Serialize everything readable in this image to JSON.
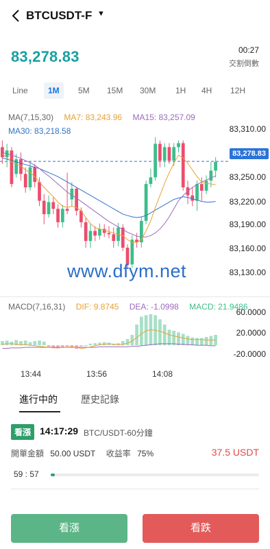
{
  "header": {
    "title": "BTCUSDT-F"
  },
  "ticker": {
    "price": "83,278.83",
    "countdown": "00:27",
    "countdown_label": "交割倒數"
  },
  "intervals": [
    "Line",
    "1M",
    "5M",
    "15M",
    "30M",
    "1H",
    "4H",
    "12H"
  ],
  "active_interval": "1M",
  "indicators": {
    "ma_label": "MA(7,15,30)",
    "ma7": "MA7: 83,243.96",
    "ma15": "MA15: 83,257.09",
    "ma30": "MA30: 83,218.58"
  },
  "colors": {
    "up": "#3ebd8a",
    "down": "#ec4d6d",
    "ma7": "#e8a033",
    "ma15": "#9b6bbd",
    "ma30": "#2f73c8",
    "price_text": "#1aa0a0"
  },
  "price_axis": [
    "83,310.00",
    "83,278.83",
    "83,250.00",
    "83,220.00",
    "83,190.00",
    "83,160.00",
    "83,130.00"
  ],
  "watermark": "www.dfym.net",
  "macd": {
    "label": "MACD(7,16,31)",
    "dif": "DIF: 9.8745",
    "dea": "DEA: -1.0998",
    "macd": "MACD: 21.9486",
    "axis": [
      "60.0000",
      "20.0000",
      "-20.0000"
    ]
  },
  "time_axis": [
    "13:44",
    "13:56",
    "14:08"
  ],
  "tabs": {
    "active": "進行中的",
    "history": "歷史記錄"
  },
  "order": {
    "direction": "看漲",
    "time": "14:17:29",
    "pair": "BTC/USDT-60分鐘",
    "amount_label": "開單金額",
    "amount": "50.00 USDT",
    "rate_label": "收益率",
    "rate": "75%",
    "profit": "37.5 USDT",
    "timer": "59 : 57",
    "progress": 0.02
  },
  "actions": {
    "call": "看漲",
    "put": "看跌"
  },
  "chart_data": {
    "type": "candlestick",
    "y_range": [
      83110,
      83325
    ],
    "last_price": 83278.83,
    "candles": [
      [
        83300,
        83285,
        83310,
        83275
      ],
      [
        83285,
        83295,
        83305,
        83270
      ],
      [
        83295,
        83245,
        83300,
        83240
      ],
      [
        83260,
        83282,
        83290,
        83255
      ],
      [
        83282,
        83260,
        83292,
        83250
      ],
      [
        83260,
        83240,
        83270,
        83232
      ],
      [
        83240,
        83270,
        83278,
        83235
      ],
      [
        83270,
        83248,
        83275,
        83240
      ],
      [
        83248,
        83220,
        83255,
        83212
      ],
      [
        83220,
        83200,
        83230,
        83185
      ],
      [
        83200,
        83218,
        83228,
        83195
      ],
      [
        83218,
        83208,
        83225,
        83200
      ],
      [
        83208,
        83188,
        83215,
        83180
      ],
      [
        83188,
        83208,
        83214,
        83180
      ],
      [
        83208,
        83205,
        83262,
        83200
      ],
      [
        83222,
        83238,
        83248,
        83212
      ],
      [
        83238,
        83205,
        83240,
        83198
      ],
      [
        83205,
        83188,
        83210,
        83180
      ],
      [
        83188,
        83160,
        83195,
        83150
      ],
      [
        83160,
        83175,
        83185,
        83150
      ],
      [
        83175,
        83168,
        83182,
        83160
      ],
      [
        83168,
        83178,
        83186,
        83162
      ],
      [
        83178,
        83172,
        83185,
        83166
      ],
      [
        83172,
        83170,
        83182,
        83164
      ],
      [
        83170,
        83160,
        83180,
        83150
      ],
      [
        83160,
        83180,
        83187,
        83152
      ],
      [
        83180,
        83150,
        83185,
        83145
      ],
      [
        83150,
        83125,
        83155,
        83120
      ],
      [
        83125,
        83162,
        83168,
        83120
      ],
      [
        83162,
        83158,
        83172,
        83150
      ],
      [
        83158,
        83190,
        83196,
        83150
      ],
      [
        83190,
        83245,
        83250,
        83185
      ],
      [
        83245,
        83255,
        83268,
        83240
      ],
      [
        83255,
        83305,
        83315,
        83250
      ],
      [
        83305,
        83280,
        83310,
        83270
      ],
      [
        83280,
        83300,
        83306,
        83270
      ],
      [
        83300,
        83280,
        83306,
        83275
      ],
      [
        83280,
        83300,
        83306,
        83272
      ],
      [
        83300,
        83306,
        83310,
        83292
      ],
      [
        83306,
        83240,
        83310,
        83235
      ],
      [
        83240,
        83228,
        83250,
        83215
      ],
      [
        83228,
        83220,
        83240,
        83212
      ],
      [
        83220,
        83245,
        83250,
        83205
      ],
      [
        83245,
        83235,
        83255,
        83220
      ],
      [
        83235,
        83250,
        83258,
        83230
      ],
      [
        83250,
        83265,
        83278,
        83240
      ],
      [
        83265,
        83278,
        83285,
        83255
      ]
    ],
    "ma7": [
      83290,
      83284,
      83278,
      83275,
      83272,
      83266,
      83262,
      83256,
      83248,
      83240,
      83233,
      83226,
      83218,
      83212,
      83210,
      83212,
      83210,
      83205,
      83195,
      83186,
      83180,
      83178,
      83176,
      83174,
      83172,
      83170,
      83168,
      83162,
      83158,
      83158,
      83162,
      83175,
      83190,
      83210,
      83228,
      83246,
      83262,
      83276,
      83288,
      83284,
      83276,
      83266,
      83256,
      83248,
      83246,
      83245,
      83244
    ],
    "ma15": [
      83292,
      83290,
      83288,
      83286,
      83283,
      83280,
      83277,
      83273,
      83268,
      83262,
      83257,
      83251,
      83245,
      83239,
      83233,
      83228,
      83224,
      83219,
      83214,
      83209,
      83204,
      83199,
      83194,
      83189,
      83185,
      83181,
      83177,
      83173,
      83170,
      83167,
      83166,
      83166,
      83168,
      83172,
      83178,
      83186,
      83196,
      83208,
      83220,
      83228,
      83234,
      83240,
      83244,
      83248,
      83251,
      83254,
      83257
    ],
    "ma30": [
      83284,
      83282,
      83280,
      83278,
      83276,
      83274,
      83272,
      83270,
      83268,
      83265,
      83262,
      83259,
      83256,
      83252,
      83248,
      83244,
      83240,
      83236,
      83232,
      83228,
      83224,
      83220,
      83216,
      83212,
      83208,
      83204,
      83200,
      83198,
      83196,
      83195,
      83196,
      83198,
      83202,
      83206,
      83210,
      83214,
      83218,
      83222,
      83224,
      83226,
      83225,
      83223,
      83221,
      83219,
      83218,
      83218,
      83219
    ],
    "macd_range": [
      -25,
      65
    ],
    "macd_hist": [
      8,
      9,
      7,
      10,
      8,
      9,
      6,
      8,
      9,
      7,
      -3,
      -4,
      -6,
      -5,
      -3,
      -4,
      -7,
      -2,
      -1,
      3,
      4,
      5,
      6,
      5,
      3,
      4,
      8,
      12,
      20,
      40,
      55,
      58,
      60,
      58,
      50,
      40,
      30,
      28,
      25,
      22,
      18,
      15,
      14,
      14,
      16,
      18,
      20
    ],
    "dif": [
      2,
      3,
      3,
      2,
      1,
      1,
      0,
      -1,
      -2,
      -3,
      -4,
      -5,
      -5,
      -4,
      -4,
      -3,
      -4,
      -6,
      -5,
      -3,
      -1,
      1,
      2,
      3,
      2,
      1,
      2,
      4,
      8,
      15,
      22,
      28,
      30,
      29,
      27,
      24,
      20,
      18,
      16,
      14,
      12,
      11,
      11,
      11,
      10,
      10,
      10
    ],
    "dea": [
      -6,
      -6,
      -5,
      -5,
      -5,
      -4,
      -4,
      -4,
      -4,
      -4,
      -4,
      -4,
      -4,
      -4,
      -4,
      -4,
      -4,
      -4,
      -4,
      -4,
      -4,
      -3,
      -3,
      -3,
      -3,
      -3,
      -3,
      -3,
      -2,
      -2,
      -1,
      0,
      1,
      2,
      3,
      3,
      3,
      3,
      2,
      2,
      1,
      1,
      0,
      0,
      0,
      -1,
      -1
    ]
  }
}
